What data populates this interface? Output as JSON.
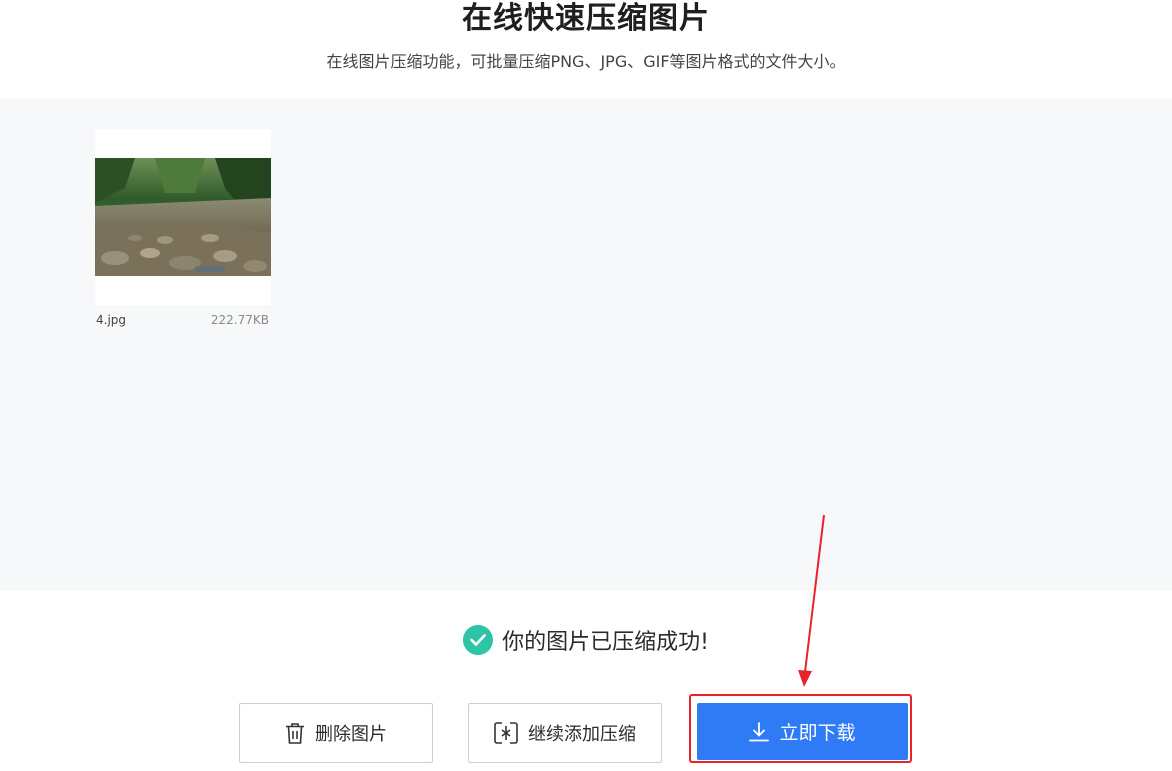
{
  "header": {
    "title": "在线快速压缩图片",
    "subtitle": "在线图片压缩功能，可批量压缩PNG、JPG、GIF等图片格式的文件大小。"
  },
  "files": [
    {
      "name": "4.jpg",
      "size": "222.77KB",
      "thumbnail_icon": "river-forest-image"
    }
  ],
  "status": {
    "message": "你的图片已压缩成功!",
    "icon": "check-circle-icon",
    "color": "#2ec4a6"
  },
  "actions": {
    "delete_label": "删除图片",
    "add_label": "继续添加压缩",
    "download_label": "立即下载"
  },
  "colors": {
    "primary": "#2f7bf5",
    "annotation": "#e8232a",
    "workspace_bg": "#f7f8fa"
  }
}
